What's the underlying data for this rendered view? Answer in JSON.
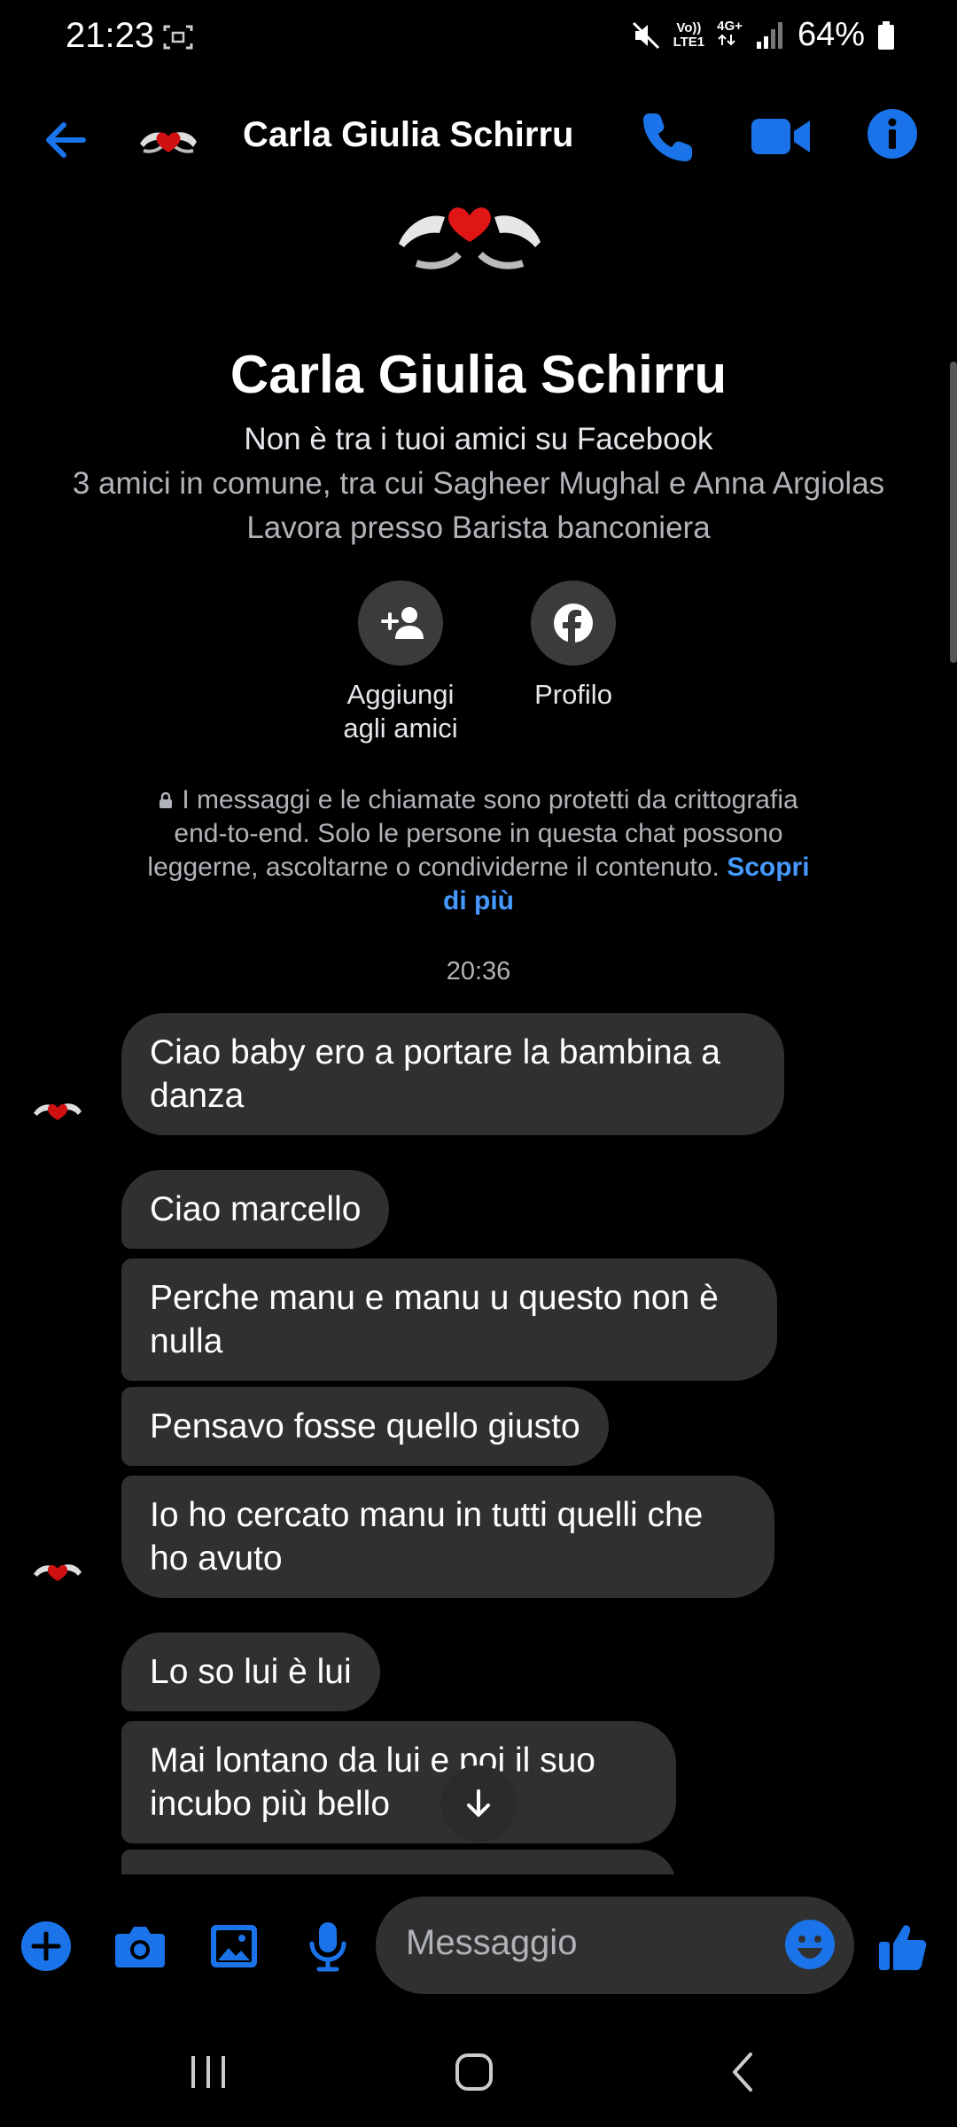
{
  "status_bar": {
    "time": "21:23",
    "network_volte": "Vo))",
    "network_lte": "LTE1",
    "network_type": "4G+",
    "battery": "64%"
  },
  "header": {
    "contact_name": "Carla Giulia Schirru",
    "icons": [
      "back-arrow-icon",
      "phone-icon",
      "video-camera-icon",
      "info-icon"
    ]
  },
  "profile": {
    "name": "Carla Giulia Schirru",
    "friend_status": "Non è tra i tuoi amici su Facebook",
    "mutual_friends": "3 amici in comune, tra cui Sagheer Mughal e Anna Argiolas",
    "work": "Lavora presso Barista banconiera",
    "actions": {
      "add_friend_line1": "Aggiungi",
      "add_friend_line2": "agli amici",
      "profile": "Profilo"
    }
  },
  "e2e_notice": {
    "text": "I messaggi e le chiamate sono protetti da crittografia end-to-end. Solo le persone in questa chat possono leggerne, ascoltarne o condividerne il contenuto.",
    "link": "Scopri di più"
  },
  "timestamp": "20:36",
  "messages": [
    {
      "text": "Ciao baby ero a portare la bambina a danza"
    },
    {
      "text": "Ciao marcello"
    },
    {
      "text": "Perche manu e manu u questo non è nulla"
    },
    {
      "text": "Pensavo fosse quello giusto"
    },
    {
      "text": "Io ho cercato manu in tutti quelli che ho avuto"
    },
    {
      "text": "Lo so lui è lui"
    },
    {
      "text": "Mai lontano da lui e poi il  suo incubo più bello"
    }
  ],
  "composer": {
    "placeholder": "Messaggio",
    "icons": [
      "plus-icon",
      "camera-icon",
      "gallery-icon",
      "microphone-icon",
      "emoji-icon",
      "thumbs-up-icon"
    ]
  },
  "colors": {
    "accent": "#1a73e8",
    "background": "#000000",
    "bubble": "#303030",
    "link": "#4599ff"
  }
}
